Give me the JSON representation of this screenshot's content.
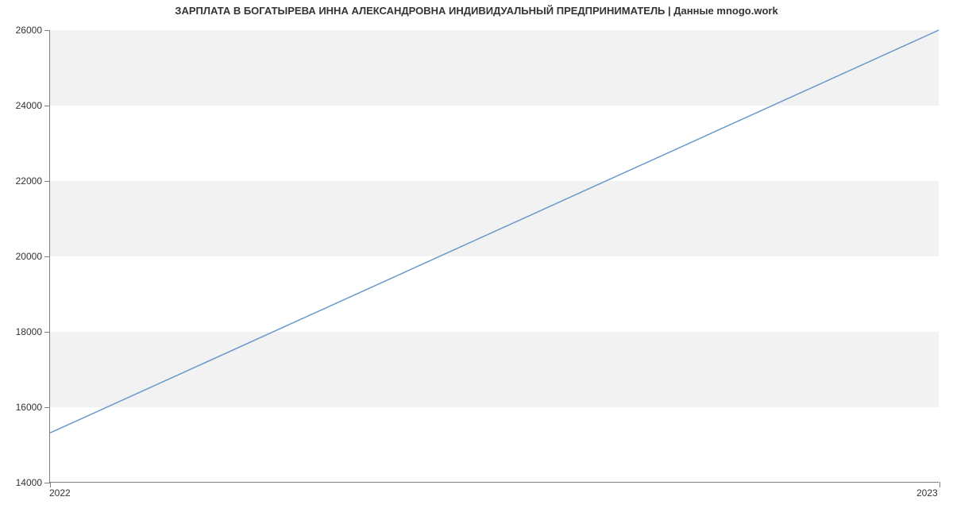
{
  "chart_data": {
    "type": "line",
    "title": "ЗАРПЛАТА В БОГАТЫРЕВА ИННА АЛЕКСАНДРОВНА ИНДИВИДУАЛЬНЫЙ ПРЕДПРИНИМАТЕЛЬ | Данные mnogo.work",
    "x": [
      "2022",
      "2023"
    ],
    "values": [
      15300,
      26000
    ],
    "xlabel": "",
    "ylabel": "",
    "ylim": [
      14000,
      26000
    ],
    "yticks": [
      14000,
      16000,
      18000,
      20000,
      22000,
      24000,
      26000
    ],
    "line_color": "#6699cc",
    "band_color": "#f2f2f2"
  }
}
